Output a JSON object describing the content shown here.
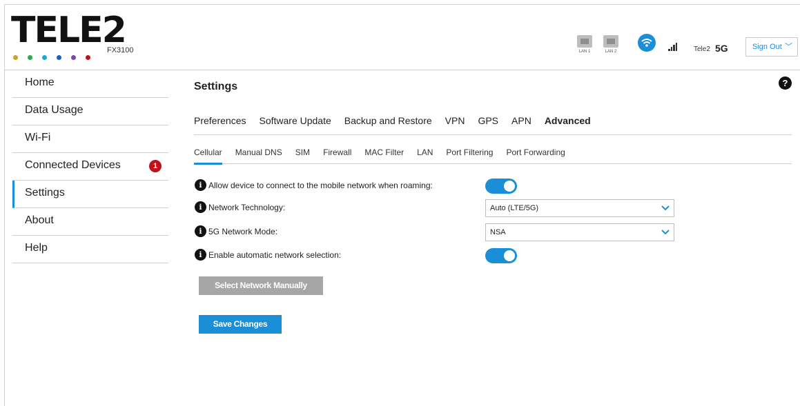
{
  "header": {
    "brand": "TELE2",
    "model": "FX3100",
    "brand_dot_colors": [
      "#c9a227",
      "#2ea84a",
      "#1aa7d6",
      "#1f5fb8",
      "#7b4aa0",
      "#c0101a"
    ],
    "lan_ports": [
      {
        "label": "LAN 1"
      },
      {
        "label": "LAN 2"
      }
    ],
    "carrier": "Tele2",
    "network_type": "5G",
    "sign_out_label": "Sign Out"
  },
  "sidebar": {
    "items": [
      {
        "label": "Home"
      },
      {
        "label": "Data Usage"
      },
      {
        "label": "Wi-Fi"
      },
      {
        "label": "Connected Devices",
        "badge": "1"
      },
      {
        "label": "Settings",
        "active": true
      },
      {
        "label": "About"
      },
      {
        "label": "Help"
      }
    ]
  },
  "main": {
    "title": "Settings",
    "tabs": [
      {
        "label": "Preferences"
      },
      {
        "label": "Software Update"
      },
      {
        "label": "Backup and Restore"
      },
      {
        "label": "VPN"
      },
      {
        "label": "GPS"
      },
      {
        "label": "APN"
      },
      {
        "label": "Advanced",
        "active": true
      }
    ],
    "subtabs": [
      {
        "label": "Cellular",
        "active": true
      },
      {
        "label": "Manual DNS"
      },
      {
        "label": "SIM"
      },
      {
        "label": "Firewall"
      },
      {
        "label": "MAC Filter"
      },
      {
        "label": "LAN"
      },
      {
        "label": "Port Filtering"
      },
      {
        "label": "Port Forwarding"
      }
    ],
    "settings": {
      "roaming": {
        "label": "Allow device to connect to the mobile network when roaming:",
        "enabled": true
      },
      "network_technology": {
        "label": "Network Technology:",
        "value": "Auto (LTE/5G)"
      },
      "network_mode": {
        "label": "5G Network Mode:",
        "value": "NSA"
      },
      "auto_selection": {
        "label": "Enable automatic network selection:",
        "enabled": true
      }
    },
    "select_network_label": "Select Network Manually",
    "save_label": "Save Changes"
  },
  "colors": {
    "accent": "#1a8fd8",
    "badge": "#c0101a",
    "disabled_button": "#a6a6a6"
  }
}
